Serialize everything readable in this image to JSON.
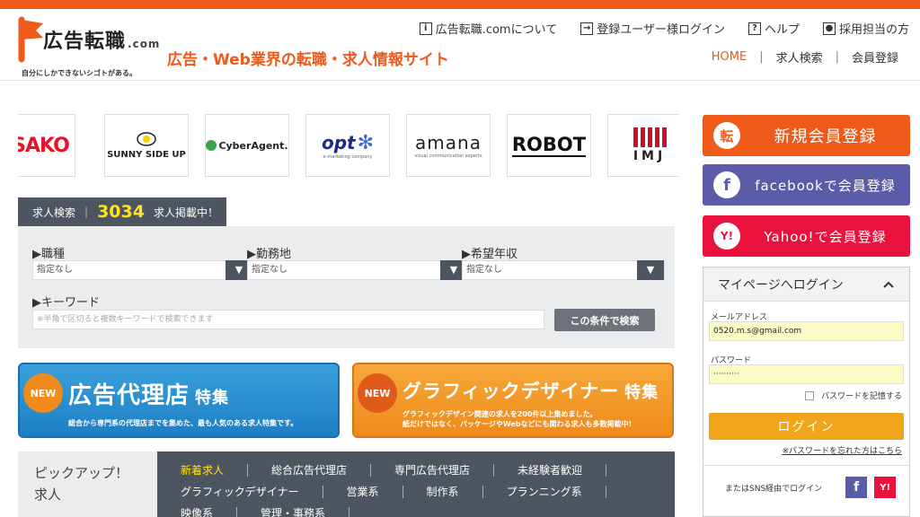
{
  "header": {
    "logo_title": "広告転職",
    "logo_tld": ".com",
    "logo_tagline": "自分にしかできないシゴトがある。",
    "tagline": "広告・Web業界の転職・求人情報サイト",
    "top_links": [
      {
        "icon": "info-icon",
        "glyph": "i",
        "label": "広告転職.comについて"
      },
      {
        "icon": "login-icon",
        "glyph": "→",
        "label": "登録ユーザー様ログイン"
      },
      {
        "icon": "help-icon",
        "glyph": "?",
        "label": "ヘルプ"
      },
      {
        "icon": "person-icon",
        "glyph": "●",
        "label": "採用担当の方"
      }
    ],
    "subnav": [
      "HOME",
      "求人検索",
      "会員登録"
    ],
    "colors": {
      "accent": "#ee5a1a"
    }
  },
  "logos": [
    "ASAKO",
    "SUNNY SIDE UP",
    "CyberAgent.",
    "opt",
    "amana",
    "ROBOT",
    "IMJ"
  ],
  "logo_subs": {
    "opt": "e-marketing company",
    "amana": "visual communication experts"
  },
  "search": {
    "tab_label": "求人検索",
    "count": "3034",
    "count_suffix": "求人掲載中！",
    "fields": [
      {
        "label": "▶職種",
        "value": "指定なし"
      },
      {
        "label": "▶勤務地",
        "value": "指定なし"
      },
      {
        "label": "▶希望年収",
        "value": "指定なし"
      }
    ],
    "keyword_label": "▶キーワード",
    "keyword_placeholder": "※半角で区切ると複数キーワードで検索できます",
    "button": "この条件で検索"
  },
  "banners": [
    {
      "badge": "NEW",
      "title": "広告代理店",
      "suffix": "特集",
      "desc": [
        "総合から専門系の代理店までを集めた、最も人気のある求人特集です。"
      ]
    },
    {
      "badge": "NEW",
      "title": "グラフィックデザイナー",
      "suffix": "特集",
      "desc": [
        "グラフィックデザイン関連の求人を200件以上集めました。",
        "紙だけではなく、パッケージやWebなどにも関わる求人も多数掲載中!"
      ]
    }
  ],
  "pickup": {
    "title_line1": "ピックアップ！",
    "title_line2": "求人",
    "row1": [
      "新着求人",
      "総合広告代理店",
      "専門広告代理店",
      "未経験者歓迎"
    ],
    "row2": [
      "グラフィックデザイナー",
      "営業系",
      "制作系",
      "プランニング系"
    ],
    "row3": [
      "映像系",
      "管理・事務系"
    ]
  },
  "sidebar": {
    "register": {
      "icon_glyph": "転",
      "label": "新規会員登録",
      "color": "#ee5a1a"
    },
    "facebook": {
      "icon_glyph": "f",
      "label": "facebookで会員登録",
      "color": "#5b5ca8"
    },
    "yahoo": {
      "icon_glyph": "Y!",
      "label": "Yahoo!で会員登録",
      "color": "#e8123c"
    }
  },
  "login": {
    "title": "マイページへログイン",
    "email_label": "メールアドレス",
    "email_value": "0520.m.s@gmail.com",
    "password_label": "パスワード",
    "password_value": "··········",
    "remember_label": "パスワードを記憶する",
    "button": "ログイン",
    "forgot": "※パスワードを忘れた方はこちら",
    "sns_label": "またはSNS経由でログイン",
    "sns_fb": "f",
    "sns_yahoo": "Y!"
  }
}
